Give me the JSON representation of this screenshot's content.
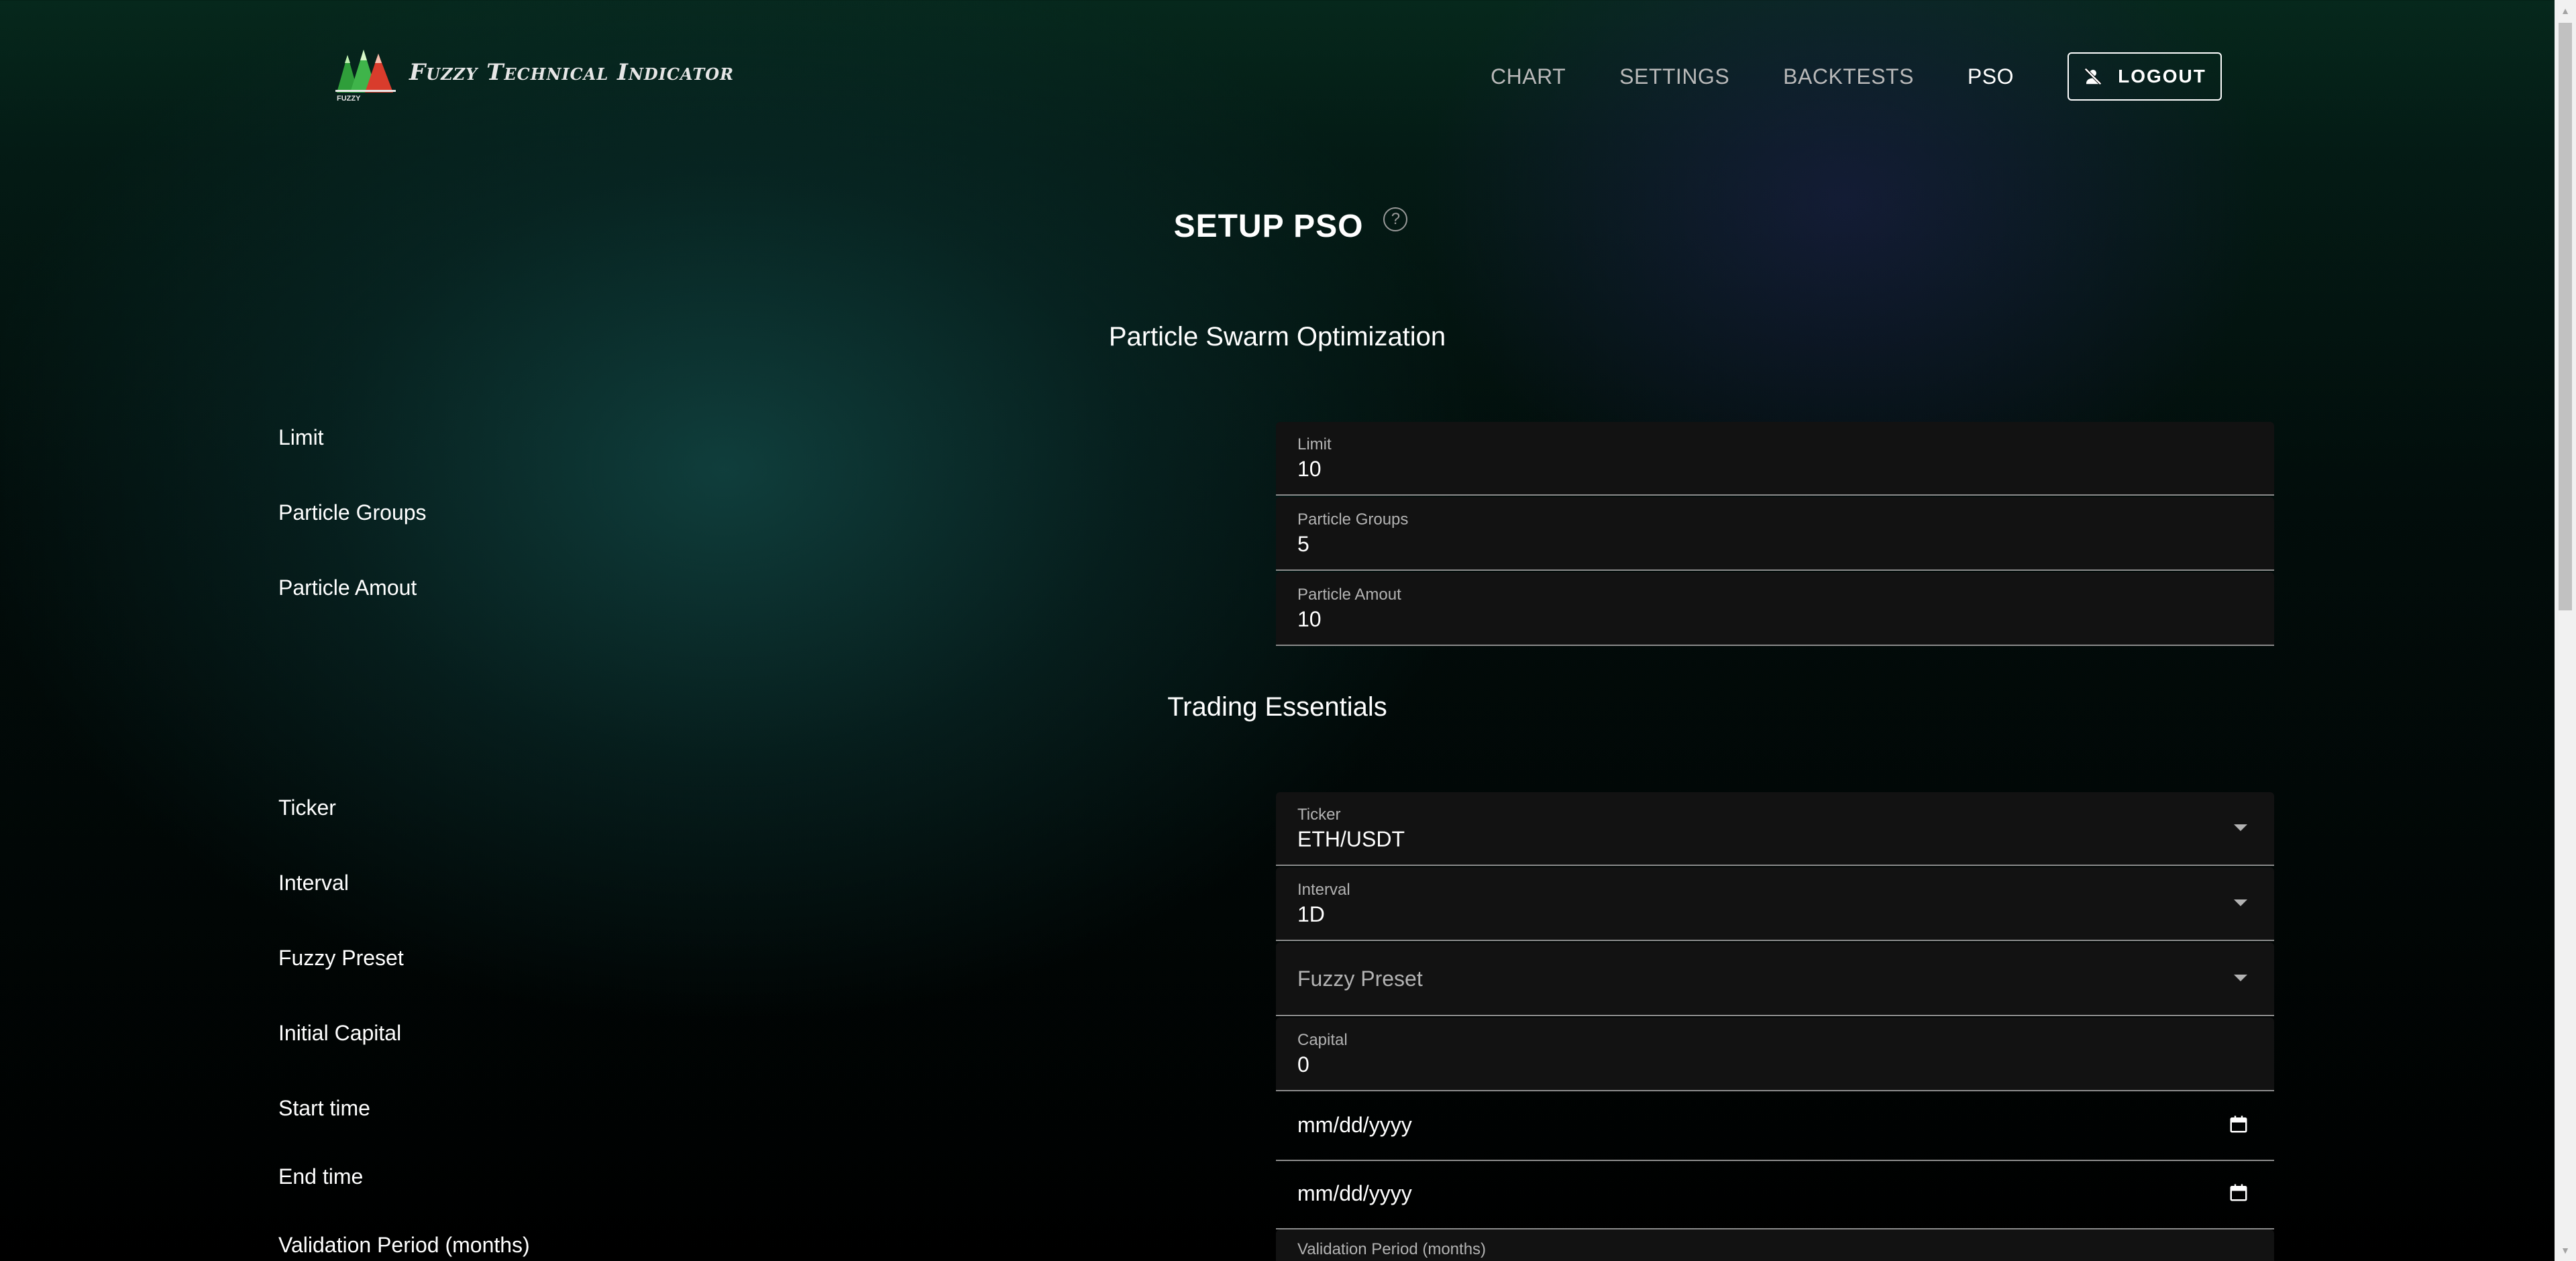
{
  "header": {
    "logo_text": "Fuzzy Technical Indicator",
    "logo_small_text": "FUZZY",
    "nav": [
      {
        "label": "CHART"
      },
      {
        "label": "SETTINGS"
      },
      {
        "label": "BACKTESTS"
      },
      {
        "label": "PSO"
      }
    ],
    "active_nav": "PSO",
    "logout_label": "LOGOUT"
  },
  "page": {
    "title": "SETUP PSO",
    "help_icon": "?"
  },
  "pso_section": {
    "title": "Particle Swarm Optimization",
    "rows": [
      {
        "label": "Limit",
        "field_label": "Limit",
        "value": "10"
      },
      {
        "label": "Particle Groups",
        "field_label": "Particle Groups",
        "value": "5"
      },
      {
        "label": "Particle Amout",
        "field_label": "Particle Amout",
        "value": "10"
      }
    ]
  },
  "trading_section": {
    "title": "Trading Essentials",
    "ticker": {
      "label": "Ticker",
      "field_label": "Ticker",
      "value": "ETH/USDT"
    },
    "interval": {
      "label": "Interval",
      "field_label": "Interval",
      "value": "1D"
    },
    "fuzzy_preset": {
      "label": "Fuzzy Preset",
      "placeholder": "Fuzzy Preset"
    },
    "capital": {
      "label": "Initial Capital",
      "field_label": "Capital",
      "value": "0"
    },
    "start_time": {
      "label": "Start time",
      "value": "mm/dd/yyyy"
    },
    "end_time": {
      "label": "End time",
      "value": "mm/dd/yyyy"
    },
    "validation": {
      "label": "Validation Period (months)",
      "field_label": "Validation Period (months)"
    }
  },
  "colors": {
    "field_bg": "#121212",
    "text": "#ffffff",
    "muted": "#b3b3b3"
  }
}
